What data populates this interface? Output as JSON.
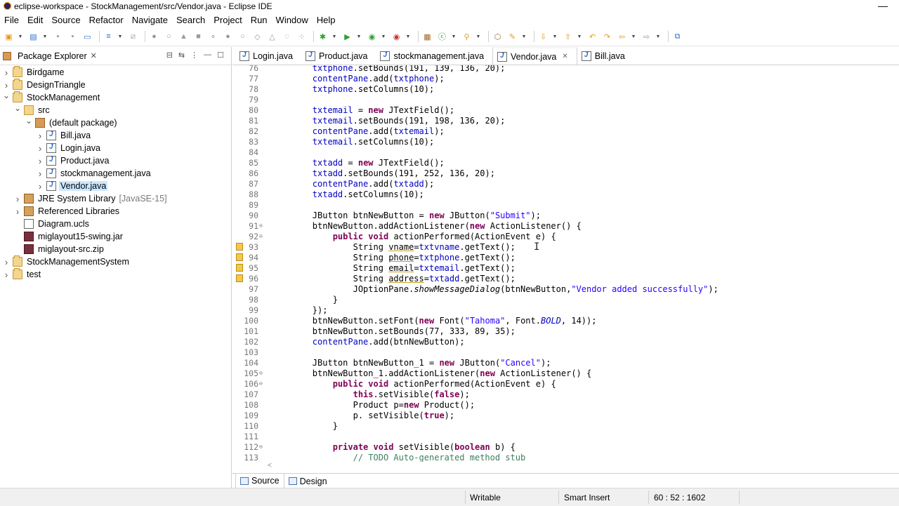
{
  "window": {
    "title": "eclipse-workspace - StockManagement/src/Vendor.java - Eclipse IDE"
  },
  "menu": [
    "File",
    "Edit",
    "Source",
    "Refactor",
    "Navigate",
    "Search",
    "Project",
    "Run",
    "Window",
    "Help"
  ],
  "package_explorer": {
    "title": "Package Explorer",
    "tree": [
      {
        "label": "Birdgame",
        "icon": "project-icon",
        "twisty": "collapsed"
      },
      {
        "label": "DesignTriangle",
        "icon": "project-icon",
        "twisty": "collapsed"
      },
      {
        "label": "StockManagement",
        "icon": "project-icon",
        "twisty": "expanded"
      },
      {
        "label": "src",
        "icon": "source-folder-icon",
        "twisty": "expanded"
      },
      {
        "label": "(default package)",
        "icon": "package-icon",
        "twisty": "expanded"
      },
      {
        "label": "Bill.java",
        "icon": "java-file-icon",
        "twisty": "collapsed"
      },
      {
        "label": "Login.java",
        "icon": "java-file-icon",
        "twisty": "collapsed"
      },
      {
        "label": "Product.java",
        "icon": "java-file-icon",
        "twisty": "collapsed"
      },
      {
        "label": "stockmanagement.java",
        "icon": "java-file-icon",
        "twisty": "collapsed"
      },
      {
        "label": "Vendor.java",
        "icon": "java-file-icon",
        "twisty": "collapsed",
        "selected": true
      },
      {
        "label": "JRE System Library",
        "suffix": "[JavaSE-15]",
        "icon": "library-icon",
        "twisty": "collapsed"
      },
      {
        "label": "Referenced Libraries",
        "icon": "library-icon",
        "twisty": "collapsed"
      },
      {
        "label": "Diagram.ucls",
        "icon": "ucls-file-icon",
        "twisty": "none"
      },
      {
        "label": "miglayout15-swing.jar",
        "icon": "jar-icon",
        "twisty": "none"
      },
      {
        "label": "miglayout-src.zip",
        "icon": "jar-icon",
        "twisty": "none"
      },
      {
        "label": "StockManagementSystem",
        "icon": "project-icon",
        "twisty": "collapsed"
      },
      {
        "label": "test",
        "icon": "project-icon",
        "twisty": "collapsed"
      }
    ]
  },
  "editor": {
    "tabs": [
      {
        "label": "Login.java",
        "active": false
      },
      {
        "label": "Product.java",
        "active": false
      },
      {
        "label": "stockmanagement.java",
        "active": false
      },
      {
        "label": "Vendor.java",
        "active": true
      },
      {
        "label": "Bill.java",
        "active": false
      }
    ],
    "lines": [
      {
        "n": "76",
        "t": "        txtphone.setBounds(191, 139, 136, 20);"
      },
      {
        "n": "77",
        "t": "        contentPane.add(txtphone);"
      },
      {
        "n": "78",
        "t": "        txtphone.setColumns(10);"
      },
      {
        "n": "79",
        "t": ""
      },
      {
        "n": "80",
        "t": "        txtemail = new JTextField();"
      },
      {
        "n": "81",
        "t": "        txtemail.setBounds(191, 198, 136, 20);"
      },
      {
        "n": "82",
        "t": "        contentPane.add(txtemail);"
      },
      {
        "n": "83",
        "t": "        txtemail.setColumns(10);"
      },
      {
        "n": "84",
        "t": ""
      },
      {
        "n": "85",
        "t": "        txtadd = new JTextField();"
      },
      {
        "n": "86",
        "t": "        txtadd.setBounds(191, 252, 136, 20);"
      },
      {
        "n": "87",
        "t": "        contentPane.add(txtadd);"
      },
      {
        "n": "88",
        "t": "        txtadd.setColumns(10);"
      },
      {
        "n": "89",
        "t": ""
      },
      {
        "n": "90",
        "t": "        JButton btnNewButton = new JButton(\"Submit\");"
      },
      {
        "n": "91",
        "t": "        btnNewButton.addActionListener(new ActionListener() {",
        "fold": "⊖"
      },
      {
        "n": "92",
        "t": "            public void actionPerformed(ActionEvent e) {",
        "fold": "⊖"
      },
      {
        "n": "93",
        "t": "                String vname=txtvname.getText();",
        "mark": true
      },
      {
        "n": "94",
        "t": "                String phone=txtphone.getText();",
        "mark": true
      },
      {
        "n": "95",
        "t": "                String email=txtemail.getText();",
        "mark": true
      },
      {
        "n": "96",
        "t": "                String address=txtadd.getText();",
        "mark": true
      },
      {
        "n": "97",
        "t": "                JOptionPane.showMessageDialog(btnNewButton,\"Vendor added successfully\");"
      },
      {
        "n": "98",
        "t": "            }"
      },
      {
        "n": "99",
        "t": "        });"
      },
      {
        "n": "100",
        "t": "        btnNewButton.setFont(new Font(\"Tahoma\", Font.BOLD, 14));"
      },
      {
        "n": "101",
        "t": "        btnNewButton.setBounds(77, 333, 89, 35);"
      },
      {
        "n": "102",
        "t": "        contentPane.add(btnNewButton);"
      },
      {
        "n": "103",
        "t": ""
      },
      {
        "n": "104",
        "t": "        JButton btnNewButton_1 = new JButton(\"Cancel\");"
      },
      {
        "n": "105",
        "t": "        btnNewButton_1.addActionListener(new ActionListener() {",
        "fold": "⊖"
      },
      {
        "n": "106",
        "t": "            public void actionPerformed(ActionEvent e) {",
        "fold": "⊖"
      },
      {
        "n": "107",
        "t": "                this.setVisible(false);"
      },
      {
        "n": "108",
        "t": "                Product p=new Product();"
      },
      {
        "n": "109",
        "t": "                p. setVisible(true);"
      },
      {
        "n": "110",
        "t": "            }"
      },
      {
        "n": "111",
        "t": ""
      },
      {
        "n": "112",
        "t": "            private void setVisible(boolean b) {",
        "fold": "⊖"
      },
      {
        "n": "113",
        "t": "                // TODO Auto-generated method stub"
      }
    ],
    "bottom_tabs": [
      {
        "label": "Source",
        "active": true
      },
      {
        "label": "Design",
        "active": false
      }
    ]
  },
  "status": {
    "writable": "Writable",
    "insert_mode": "Smart Insert",
    "position": "60 : 52 : 1602"
  }
}
